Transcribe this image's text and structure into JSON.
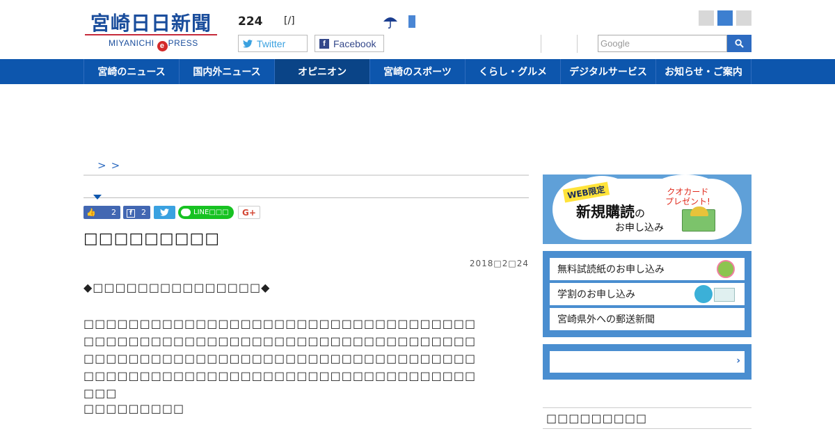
{
  "header": {
    "logo_title": "宮崎日日新聞",
    "logo_sub_pre": "MIYANICHI",
    "logo_sub_e": "e",
    "logo_sub_post": "PRESS",
    "count": "224",
    "date_slot": "[/]",
    "weather_icon": "umbrella-icon",
    "share": {
      "twitter_label": "Twitter",
      "facebook_label": "Facebook"
    },
    "search_placeholder": "Google"
  },
  "nav": {
    "items": [
      {
        "label": "宮崎のニュース"
      },
      {
        "label": "国内外ニュース"
      },
      {
        "label": "オピニオン"
      },
      {
        "label": "宮崎のスポーツ"
      },
      {
        "label": "くらし・グルメ"
      },
      {
        "label": "デジタルサービス"
      },
      {
        "label": "お知らせ・ご案内"
      }
    ],
    "active_index": 2
  },
  "breadcrumb": {
    "sep1": ">",
    "sep2": ">"
  },
  "article": {
    "social": {
      "like_count": "2",
      "fb_count": "2",
      "line_label": "LINE□□□",
      "gplus_label": "G+"
    },
    "headline": "□□□□□□□□□",
    "date": "2018□2□24",
    "lead": "◆□□□□□□□□□□□□□□□◆",
    "body": "□□□□□□□□□□□□□□□□□□□□□□□□□□□□□□□□□□□□□□□□□□□□□□□□□□□□□□□□□□□□□□□□□□□□□□□□□□□□□□□□□□□□□□□□□□□□□□□□□□□□□□□□□□□□□□□□□□□□□□□□□□□□□□□□□□□□□□□□□□□□□□□",
    "signature": "□□□□□□□□□"
  },
  "rail": {
    "promo": {
      "badge": "WEB限定",
      "main": "新規購読",
      "main_particle": "の",
      "sub": "お申し込み",
      "gift_line1": "クオカード",
      "gift_line2": "プレゼント!"
    },
    "links": [
      {
        "label": "無料試読紙のお申し込み",
        "icon": "mascot-icon"
      },
      {
        "label": "学割のお申し込み",
        "icon": "school-icon"
      },
      {
        "label": "宮崎県外への郵送新聞",
        "icon": ""
      }
    ],
    "login_arrow": "›",
    "heading": "□□□□□□□□□"
  }
}
